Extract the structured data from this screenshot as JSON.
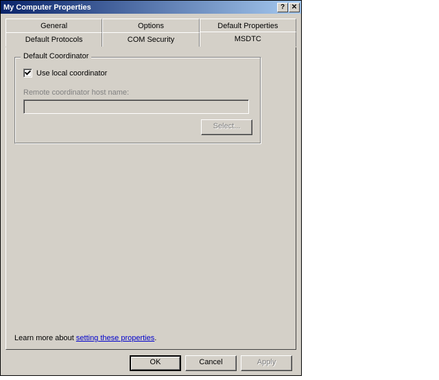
{
  "window": {
    "title": "My Computer Properties"
  },
  "tabs": {
    "row1": [
      {
        "label": "General"
      },
      {
        "label": "Options"
      },
      {
        "label": "Default Properties"
      }
    ],
    "row2": [
      {
        "label": "Default Protocols"
      },
      {
        "label": "COM Security"
      },
      {
        "label": "MSDTC",
        "active": true
      }
    ]
  },
  "group": {
    "legend": "Default Coordinator",
    "use_local_label": "Use local coordinator",
    "remote_label": "Remote coordinator host name:",
    "remote_value": "",
    "select_label": "Select..."
  },
  "learn": {
    "prefix": "Learn more about ",
    "link": "setting these properties",
    "suffix": "."
  },
  "buttons": {
    "ok": "OK",
    "cancel": "Cancel",
    "apply": "Apply"
  },
  "titlebar_icons": {
    "help": "?",
    "close": "✕"
  }
}
